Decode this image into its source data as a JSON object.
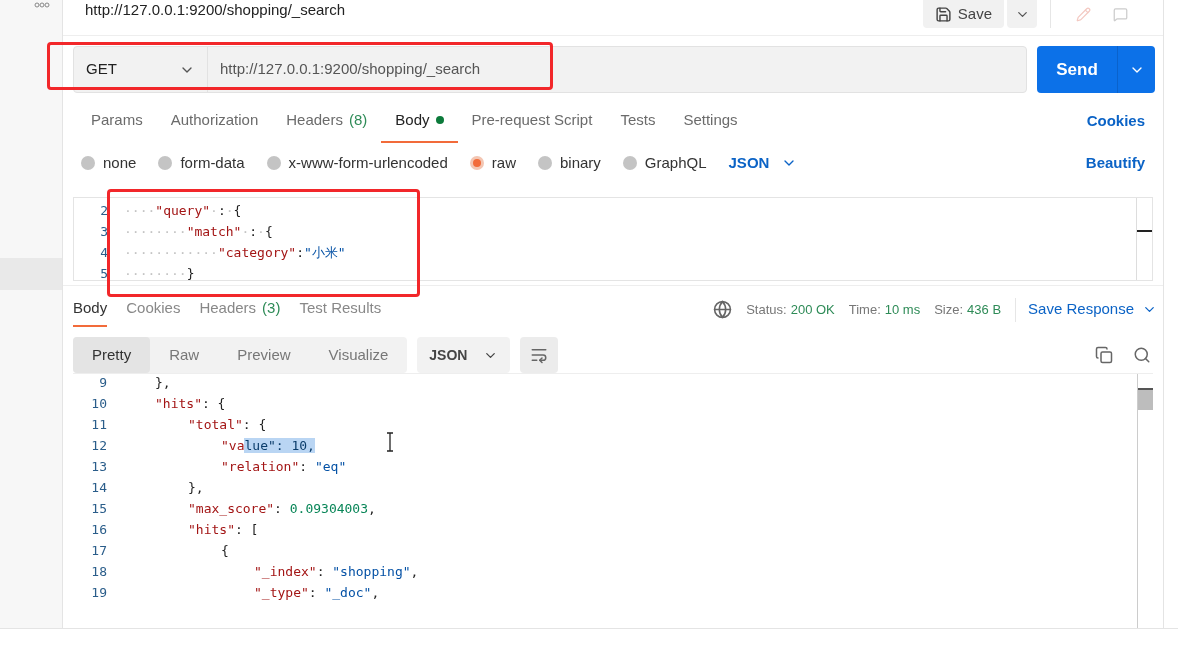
{
  "request": {
    "title": "http://127.0.0.1:9200/shopping/_search",
    "save": "Save",
    "method": "GET",
    "url": "http://127.0.0.1:9200/shopping/_search",
    "send": "Send"
  },
  "request_tabs": [
    {
      "label": "Params",
      "selected": false
    },
    {
      "label": "Authorization",
      "selected": false
    },
    {
      "label": "Headers",
      "count": "(8)",
      "selected": false
    },
    {
      "label": "Body",
      "dot": true,
      "selected": true
    },
    {
      "label": "Pre-request Script",
      "selected": false
    },
    {
      "label": "Tests",
      "selected": false
    },
    {
      "label": "Settings",
      "selected": false
    }
  ],
  "cookies_link": "Cookies",
  "body_types": [
    {
      "label": "none",
      "selected": false
    },
    {
      "label": "form-data",
      "selected": false
    },
    {
      "label": "x-www-form-urlencoded",
      "selected": false
    },
    {
      "label": "raw",
      "selected": true
    },
    {
      "label": "binary",
      "selected": false
    },
    {
      "label": "GraphQL",
      "selected": false
    }
  ],
  "raw_format": "JSON",
  "beautify": "Beautify",
  "request_body": [
    {
      "number": "2",
      "tokens": [
        {
          "kind": "space",
          "text": "····"
        },
        {
          "kind": "key",
          "text": "\"query\""
        },
        {
          "kind": "space",
          "text": "·"
        },
        {
          "kind": "punct",
          "text": ":"
        },
        {
          "kind": "space",
          "text": "·"
        },
        {
          "kind": "punct",
          "text": "{"
        }
      ]
    },
    {
      "number": "3",
      "tokens": [
        {
          "kind": "space",
          "text": "········"
        },
        {
          "kind": "key",
          "text": "\"match\""
        },
        {
          "kind": "space",
          "text": "·"
        },
        {
          "kind": "punct",
          "text": ":"
        },
        {
          "kind": "space",
          "text": "·"
        },
        {
          "kind": "punct",
          "text": "{"
        }
      ]
    },
    {
      "number": "4",
      "tokens": [
        {
          "kind": "space",
          "text": "············"
        },
        {
          "kind": "key",
          "text": "\"category\""
        },
        {
          "kind": "punct",
          "text": ":"
        },
        {
          "kind": "string",
          "text": "\"小米\""
        }
      ]
    },
    {
      "number": "5",
      "tokens": [
        {
          "kind": "space",
          "text": "········"
        },
        {
          "kind": "punct",
          "text": "}"
        }
      ]
    }
  ],
  "response_tabs": [
    {
      "label": "Body",
      "selected": true
    },
    {
      "label": "Cookies",
      "selected": false
    },
    {
      "label": "Headers",
      "count": "(3)",
      "selected": false
    },
    {
      "label": "Test Results",
      "selected": false
    }
  ],
  "status": {
    "status_label": "Status:",
    "status": "200 OK",
    "time_label": "Time:",
    "time": "10 ms",
    "size_label": "Size:",
    "size": "436 B",
    "save_response": "Save Response"
  },
  "view_modes": [
    {
      "label": "Pretty",
      "selected": true
    },
    {
      "label": "Raw",
      "selected": false
    },
    {
      "label": "Preview",
      "selected": false
    },
    {
      "label": "Visualize",
      "selected": false
    }
  ],
  "response_format": "JSON",
  "response_body": [
    {
      "number": "9",
      "tokens": [
        {
          "kind": "punct",
          "text": "},"
        }
      ]
    },
    {
      "number": "10",
      "tokens": [
        {
          "kind": "key",
          "text": "\"hits\""
        },
        {
          "kind": "punct",
          "text": ": {"
        }
      ],
      "children": [
        {
          "number": "11",
          "tokens": [
            {
              "kind": "key",
              "text": "\"total\""
            },
            {
              "kind": "punct",
              "text": ": {"
            }
          ],
          "children": [
            {
              "number": "12",
              "tokens": [
                {
                  "kind": "key",
                  "text": "\"va"
                },
                {
                  "kind": "selected",
                  "text": "lue\": 10,"
                }
              ]
            },
            {
              "number": "13",
              "tokens": [
                {
                  "kind": "key",
                  "text": "\"relation\""
                },
                {
                  "kind": "punct",
                  "text": ": "
                },
                {
                  "kind": "string",
                  "text": "\"eq\""
                }
              ]
            }
          ]
        },
        {
          "number": "14",
          "tokens": [
            {
              "kind": "punct",
              "text": "},"
            }
          ]
        },
        {
          "number": "15",
          "tokens": [
            {
              "kind": "key",
              "text": "\"max_score\""
            },
            {
              "kind": "punct",
              "text": ": "
            },
            {
              "kind": "number",
              "text": "0.09304003"
            },
            {
              "kind": "punct",
              "text": ","
            }
          ]
        },
        {
          "number": "16",
          "tokens": [
            {
              "kind": "key",
              "text": "\"hits\""
            },
            {
              "kind": "punct",
              "text": ": ["
            }
          ],
          "children": [
            {
              "number": "17",
              "tokens": [
                {
                  "kind": "punct",
                  "text": "{"
                }
              ],
              "children": [
                {
                  "number": "18",
                  "tokens": [
                    {
                      "kind": "key",
                      "text": "\"_index\""
                    },
                    {
                      "kind": "punct",
                      "text": ": "
                    },
                    {
                      "kind": "string",
                      "text": "\"shopping\""
                    },
                    {
                      "kind": "punct",
                      "text": ","
                    }
                  ]
                },
                {
                  "number": "19",
                  "tokens": [
                    {
                      "kind": "key",
                      "text": "\"_type\""
                    },
                    {
                      "kind": "punct",
                      "text": ": "
                    },
                    {
                      "kind": "string",
                      "text": "\"_doc\""
                    },
                    {
                      "kind": "punct",
                      "text": ","
                    }
                  ]
                }
              ]
            }
          ]
        }
      ]
    }
  ]
}
